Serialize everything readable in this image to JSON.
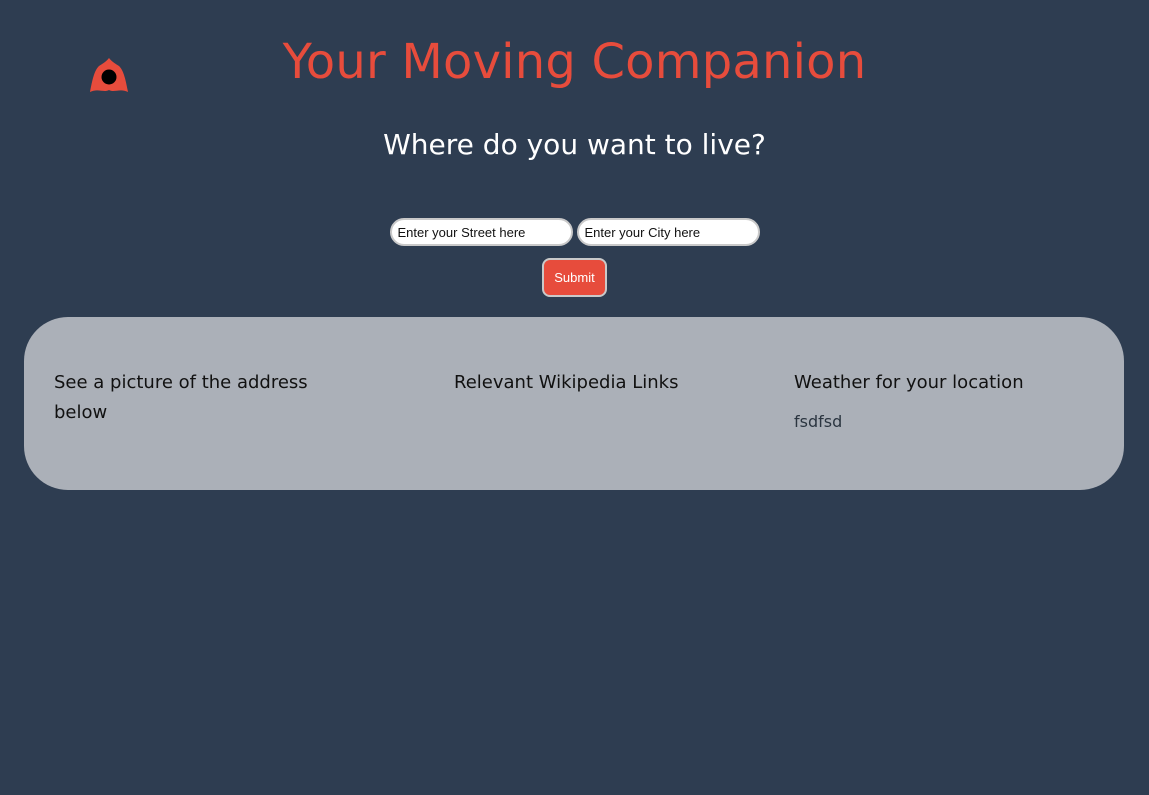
{
  "header": {
    "title": "Your Moving Companion",
    "logo_icon": "location-pin-icon"
  },
  "prompt": {
    "subtitle": "Where do you want to live?"
  },
  "form": {
    "street_placeholder": "Enter your Street here",
    "city_placeholder": "Enter your City here",
    "submit_label": "Submit"
  },
  "results": {
    "picture_heading": "See a picture of the address below",
    "wiki_heading": "Relevant Wikipedia Links",
    "weather_heading": "Weather for your location",
    "weather_text": "fsdfsd"
  },
  "colors": {
    "background": "#2e3d51",
    "accent": "#e74c3c",
    "panel": "#abb0b8"
  }
}
